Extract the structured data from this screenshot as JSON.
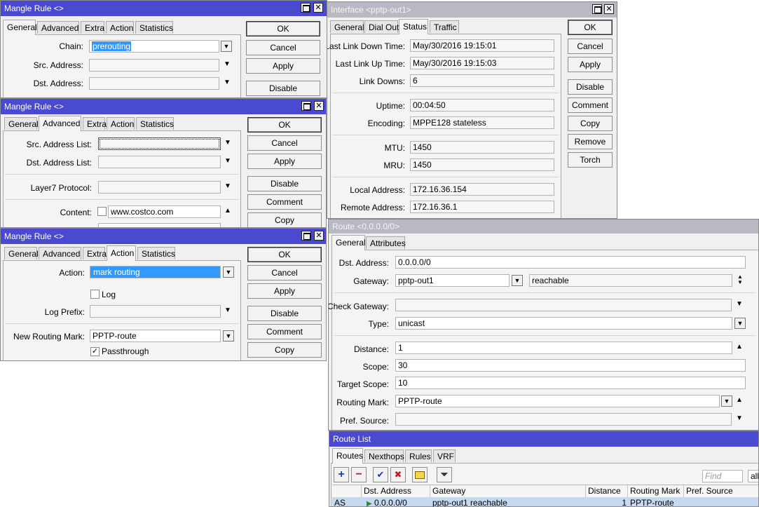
{
  "mangle1": {
    "title": "Mangle Rule <>",
    "tabs": [
      "General",
      "Advanced",
      "Extra",
      "Action",
      "Statistics"
    ],
    "chain_label": "Chain:",
    "chain_value": "prerouting",
    "src_address_label": "Src. Address:",
    "dst_address_label": "Dst. Address:",
    "buttons": [
      "OK",
      "Cancel",
      "Apply",
      "Disable"
    ]
  },
  "mangle2": {
    "title": "Mangle Rule <>",
    "tabs": [
      "General",
      "Advanced",
      "Extra",
      "Action",
      "Statistics"
    ],
    "src_address_list_label": "Src. Address List:",
    "dst_address_list_label": "Dst. Address List:",
    "layer7_label": "Layer7 Protocol:",
    "content_label": "Content:",
    "content_value": "www.costco.com",
    "buttons": [
      "OK",
      "Cancel",
      "Apply",
      "Disable",
      "Comment",
      "Copy"
    ]
  },
  "mangle3": {
    "title": "Mangle Rule <>",
    "tabs": [
      "General",
      "Advanced",
      "Extra",
      "Action",
      "Statistics"
    ],
    "action_label": "Action:",
    "action_value": "mark routing",
    "log_label": "Log",
    "log_prefix_label": "Log Prefix:",
    "new_routing_mark_label": "New Routing Mark:",
    "new_routing_mark_value": "PPTP-route",
    "passthrough_label": "Passthrough",
    "passthrough_checked": true,
    "buttons": [
      "OK",
      "Cancel",
      "Apply",
      "Disable",
      "Comment",
      "Copy"
    ]
  },
  "interface": {
    "title": "Interface <pptp-out1>",
    "tabs": [
      "General",
      "Dial Out",
      "Status",
      "Traffic"
    ],
    "fields": [
      {
        "label": "Last Link Down Time:",
        "value": "May/30/2016 19:15:01"
      },
      {
        "label": "Last Link Up Time:",
        "value": "May/30/2016 19:15:03"
      },
      {
        "label": "Link Downs:",
        "value": "6"
      },
      {
        "label": "Uptime:",
        "value": "00:04:50"
      },
      {
        "label": "Encoding:",
        "value": "MPPE128 stateless"
      },
      {
        "label": "MTU:",
        "value": "1450"
      },
      {
        "label": "MRU:",
        "value": "1450"
      },
      {
        "label": "Local Address:",
        "value": "172.16.36.154"
      },
      {
        "label": "Remote Address:",
        "value": "172.16.36.1"
      }
    ],
    "buttons": [
      "OK",
      "Cancel",
      "Apply",
      "Disable",
      "Comment",
      "Copy",
      "Remove",
      "Torch"
    ]
  },
  "route": {
    "title": "Route <0.0.0.0/0>",
    "tabs": [
      "General",
      "Attributes"
    ],
    "dst_address_label": "Dst. Address:",
    "dst_address_value": "0.0.0.0/0",
    "gateway_label": "Gateway:",
    "gateway_value": "pptp-out1",
    "gateway_state": "reachable",
    "check_gateway_label": "Check Gateway:",
    "type_label": "Type:",
    "type_value": "unicast",
    "distance_label": "Distance:",
    "distance_value": "1",
    "scope_label": "Scope:",
    "scope_value": "30",
    "target_scope_label": "Target Scope:",
    "target_scope_value": "10",
    "routing_mark_label": "Routing Mark:",
    "routing_mark_value": "PPTP-route",
    "pref_source_label": "Pref. Source:"
  },
  "route_list": {
    "title": "Route List",
    "tabs": [
      "Routes",
      "Nexthops",
      "Rules",
      "VRF"
    ],
    "find_placeholder": "Find",
    "filter_value": "all",
    "columns": [
      "",
      "Dst. Address",
      "Gateway",
      "Distance",
      "Routing Mark",
      "Pref. Source"
    ],
    "row": {
      "flags": "AS",
      "dst": "0.0.0.0/0",
      "gateway": "pptp-out1 reachable",
      "distance": "1",
      "routing_mark": "PPTP-route",
      "pref_source": ""
    }
  },
  "colors": {
    "active_title": "#4a4ad0",
    "inactive_title": "#b9b9c3",
    "selection": "#3399ff",
    "row_selected": "#c5d9f1"
  }
}
